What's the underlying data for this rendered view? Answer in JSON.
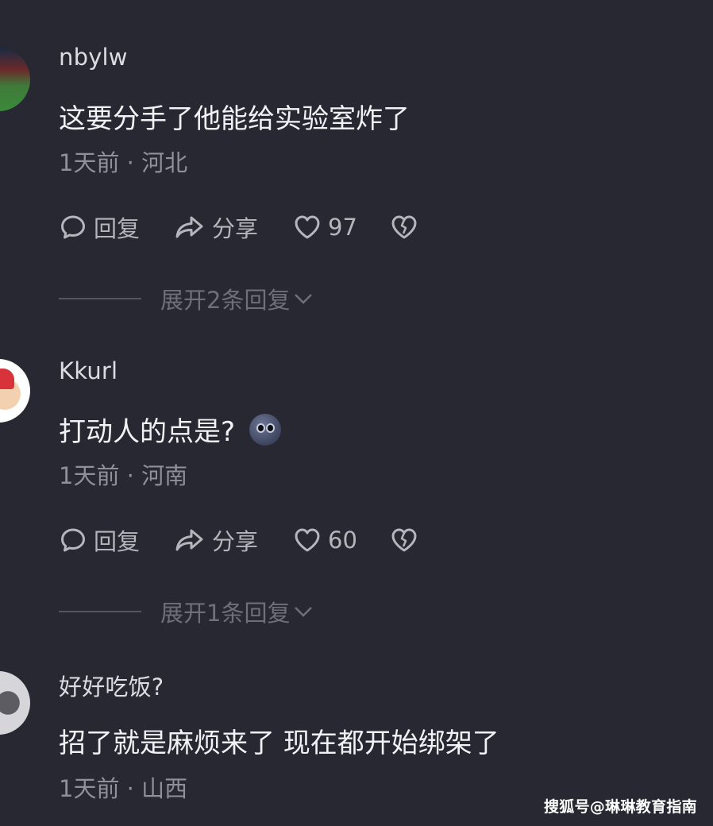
{
  "comments": [
    {
      "username": "nbylw",
      "content": "这要分手了他能给实验室炸了",
      "meta": "1天前 · 河北",
      "actions": {
        "reply_label": "回复",
        "share_label": "分享",
        "like_count": "97"
      },
      "expand_label": "展开2条回复"
    },
    {
      "username": "Kkurl",
      "content": "打动人的点是?",
      "emoji": "moon-face-emoji",
      "meta": "1天前 · 河南",
      "actions": {
        "reply_label": "回复",
        "share_label": "分享",
        "like_count": "60"
      },
      "expand_label": "展开1条回复"
    },
    {
      "username": "好好吃饭?",
      "content": "招了就是麻烦来了 现在都开始绑架了",
      "meta": "1天前 · 山西"
    }
  ],
  "watermark": "搜狐号@琳琳教育指南",
  "icons": {
    "reply": "comment-bubble-icon",
    "share": "share-arrow-icon",
    "like": "heart-icon",
    "dislike": "broken-heart-icon",
    "expand": "chevron-down-icon"
  },
  "colors": {
    "background": "#272831",
    "primary_text": "#f2f2f6",
    "secondary_text": "#8f9099",
    "action_text": "#b4b5bd"
  }
}
